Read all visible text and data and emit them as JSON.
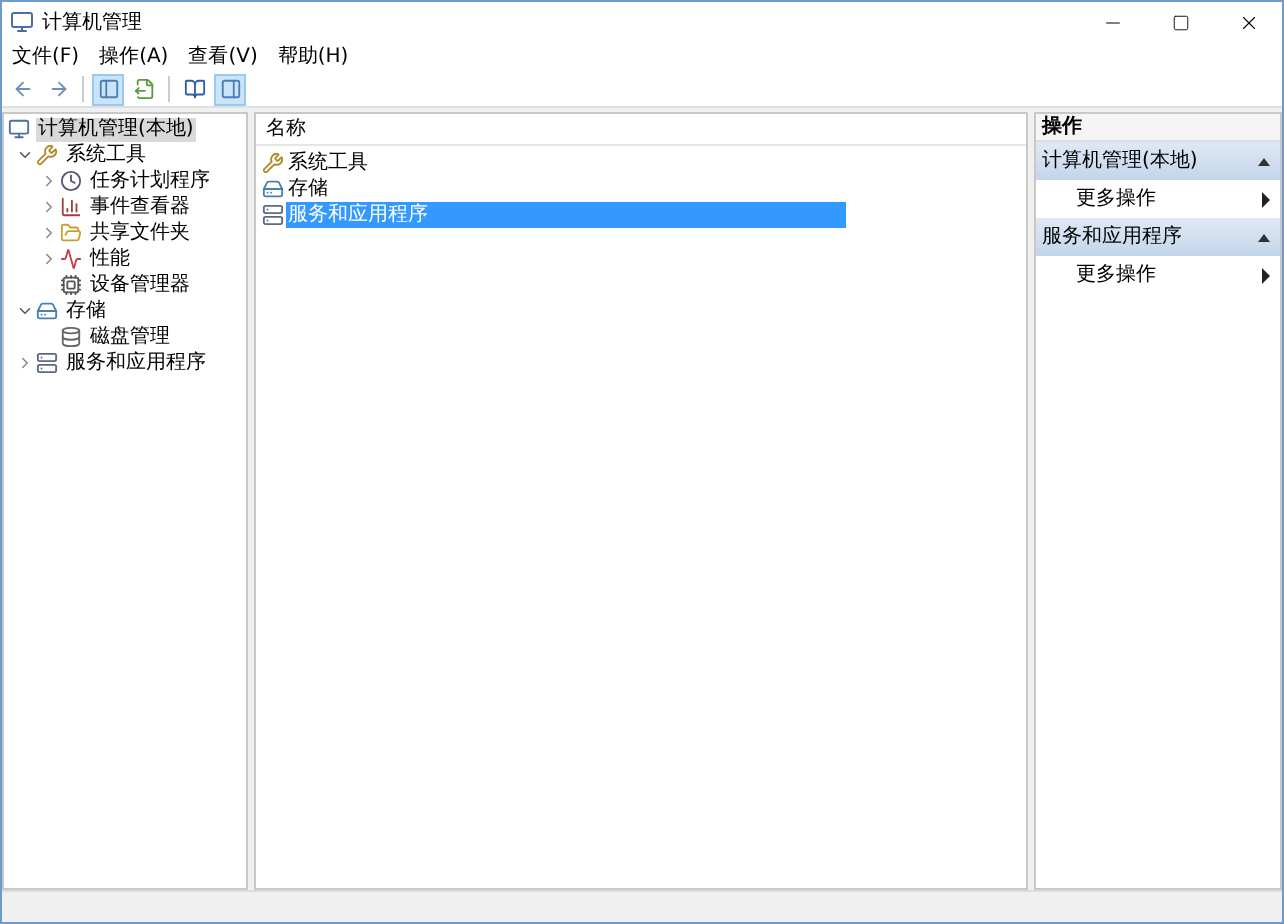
{
  "window": {
    "title": "计算机管理"
  },
  "menu": [
    "文件(F)",
    "操作(A)",
    "查看(V)",
    "帮助(H)"
  ],
  "toolbar": [
    {
      "kind": "back",
      "pressed": false
    },
    {
      "kind": "forward",
      "pressed": false
    },
    {
      "kind": "tree",
      "pressed": true
    },
    {
      "kind": "export",
      "pressed": false
    },
    {
      "kind": "help",
      "pressed": false
    },
    {
      "kind": "pane",
      "pressed": true
    }
  ],
  "tree": [
    {
      "label": "计算机管理(本地)",
      "selected": true,
      "children": [
        {
          "label": "系统工具",
          "expanded": true,
          "selected": false,
          "children": [
            {
              "label": "任务计划程序",
              "expanded": false,
              "selected": false
            },
            {
              "label": "事件查看器",
              "expanded": false,
              "selected": false
            },
            {
              "label": "共享文件夹",
              "expanded": false,
              "selected": false
            },
            {
              "label": "性能",
              "expanded": false,
              "selected": false
            },
            {
              "label": "设备管理器",
              "selected": false
            }
          ]
        },
        {
          "label": "存储",
          "expanded": true,
          "selected": false,
          "children": [
            {
              "label": "磁盘管理",
              "selected": false
            }
          ]
        },
        {
          "label": "服务和应用程序",
          "expanded": false,
          "selected": false
        }
      ]
    }
  ],
  "list": {
    "columns": [
      "名称"
    ],
    "items": [
      {
        "name": "系统工具",
        "selected": false
      },
      {
        "name": "存储",
        "selected": false
      },
      {
        "name": "服务和应用程序",
        "selected": true
      }
    ]
  },
  "actions": {
    "title": "操作",
    "sections": [
      {
        "title": "计算机管理(本地)",
        "expanded": true,
        "items": [
          "更多操作"
        ]
      },
      {
        "title": "服务和应用程序",
        "expanded": true,
        "items": [
          "更多操作"
        ]
      }
    ]
  }
}
